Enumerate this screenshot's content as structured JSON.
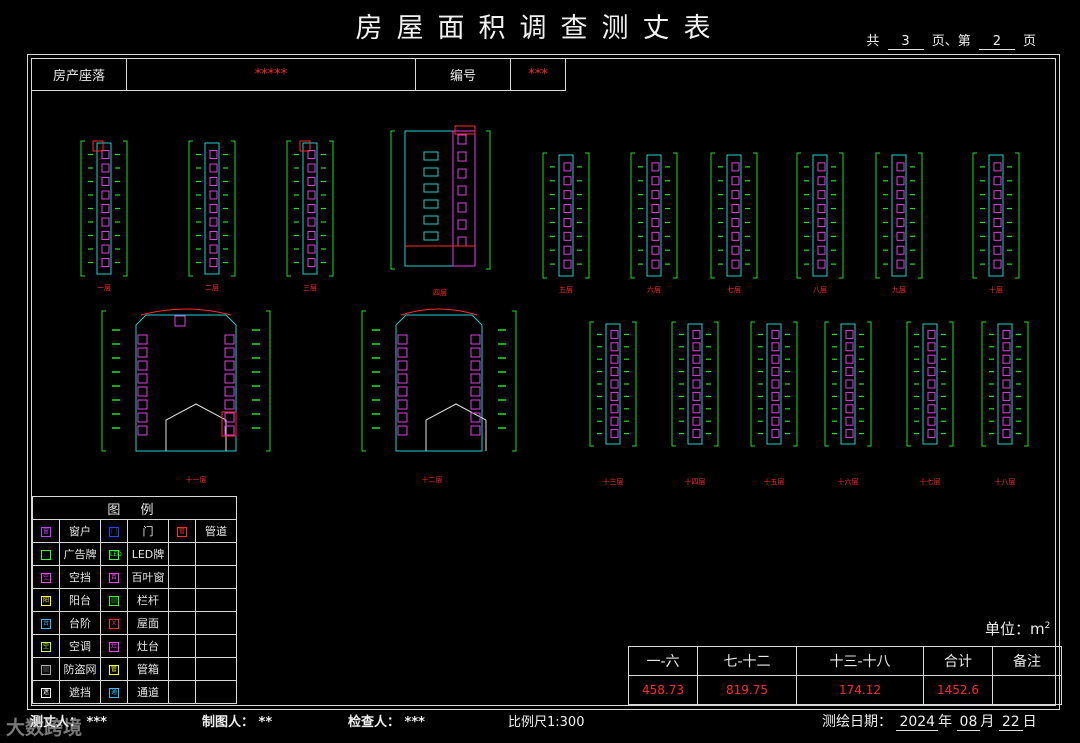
{
  "title": "房屋面积调查测丈表",
  "page_info": {
    "prefix": "共",
    "total": "3",
    "mid": "页、第",
    "current": "2",
    "suffix": "页"
  },
  "header": {
    "location_label": "房产座落",
    "location_value": "*****",
    "number_label": "编号",
    "number_value": "***"
  },
  "floor_labels": [
    "一层",
    "二层",
    "三层",
    "四层",
    "五层",
    "六层",
    "七层",
    "八层",
    "九层",
    "十层",
    "十一层",
    "十二层",
    "十三层",
    "十四层",
    "十五层",
    "十六层",
    "十七层",
    "十八层"
  ],
  "legend": {
    "title": "图  例",
    "rows": [
      [
        {
          "sym": "窗",
          "color": "#c040ff",
          "label": "窗户"
        },
        {
          "sym": "门",
          "color": "#3040ff",
          "label": "门"
        },
        {
          "sym": "管",
          "color": "#ff3030",
          "label": "管道"
        }
      ],
      [
        {
          "sym": "",
          "color": "#30ff30",
          "label": "广告牌"
        },
        {
          "sym": "LED",
          "color": "#30ff30",
          "label": "LED牌"
        },
        {
          "sym": "",
          "color": "",
          "label": ""
        }
      ],
      [
        {
          "sym": "空",
          "color": "#ff40ff",
          "label": "空挡"
        },
        {
          "sym": "百",
          "color": "#ff40ff",
          "label": "百叶窗"
        },
        {
          "sym": "",
          "color": "",
          "label": ""
        }
      ],
      [
        {
          "sym": "阳",
          "color": "#ffff30",
          "label": "阳台"
        },
        {
          "sym": "|||",
          "color": "#30ff30",
          "label": "栏杆"
        },
        {
          "sym": "",
          "color": "",
          "label": ""
        }
      ],
      [
        {
          "sym": "台",
          "color": "#30c0ff",
          "label": "台阶"
        },
        {
          "sym": "X",
          "color": "#ff3030",
          "label": "屋面"
        },
        {
          "sym": "",
          "color": "",
          "label": ""
        }
      ],
      [
        {
          "sym": "空",
          "color": "#c0ff40",
          "label": "空调"
        },
        {
          "sym": "灶",
          "color": "#ff40ff",
          "label": "灶台"
        },
        {
          "sym": "",
          "color": "",
          "label": ""
        }
      ],
      [
        {
          "sym": "|||",
          "color": "#aaaaaa",
          "label": "防盗网"
        },
        {
          "sym": "管",
          "color": "#ffff30",
          "label": "管箱"
        },
        {
          "sym": "",
          "color": "",
          "label": ""
        }
      ],
      [
        {
          "sym": "遮",
          "color": "#ffffff",
          "label": "遮挡"
        },
        {
          "sym": "通",
          "color": "#30c0ff",
          "label": "通道"
        },
        {
          "sym": "",
          "color": "",
          "label": ""
        }
      ]
    ]
  },
  "unit": {
    "label": "单位：m",
    "sup": "2"
  },
  "summary": {
    "headers": [
      "一-六",
      "七-十二",
      "十三-十八",
      "合计",
      "备注"
    ],
    "values": [
      "458.73",
      "819.75",
      "174.12",
      "1452.6",
      ""
    ]
  },
  "footer": {
    "surveyor_label": "测丈人：",
    "surveyor": "***",
    "drafter_label": "制图人：",
    "drafter": "**",
    "checker_label": "检查人：",
    "checker": "***",
    "scale": "比例尺1:300",
    "date_label": "测绘日期：",
    "year": "2024",
    "y": "年",
    "month": "08",
    "m": "月",
    "day": "22",
    "d": "日"
  },
  "watermark": "大数跨境",
  "colors": {
    "line": "#d8d8d8",
    "red": "#ff2a2a",
    "green": "#20e020",
    "cyan": "#20d0d0",
    "magenta": "#e040e0"
  }
}
